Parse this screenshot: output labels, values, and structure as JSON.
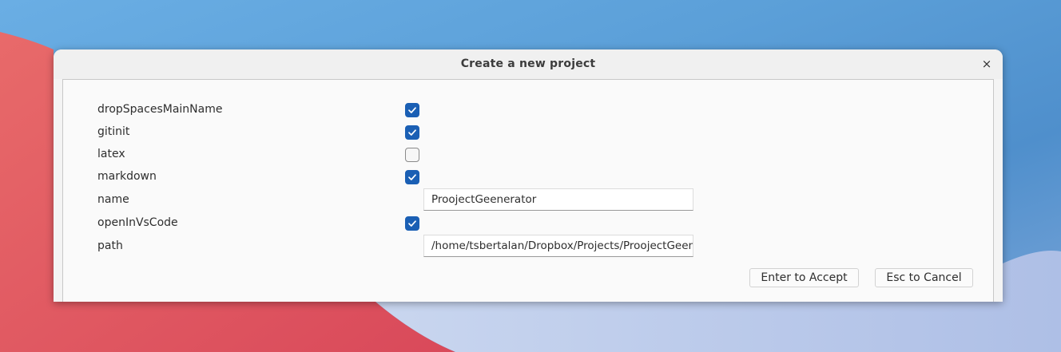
{
  "dialog": {
    "title": "Create a new project",
    "close_glyph": "×"
  },
  "fields": {
    "dropSpacesMainName": {
      "label": "dropSpacesMainName",
      "checked": true
    },
    "gitinit": {
      "label": "gitinit",
      "checked": true
    },
    "latex": {
      "label": "latex",
      "checked": false
    },
    "markdown": {
      "label": "markdown",
      "checked": true
    },
    "name": {
      "label": "name",
      "value": "ProojectGeenerator"
    },
    "openInVsCode": {
      "label": "openInVsCode",
      "checked": true
    },
    "path": {
      "label": "path",
      "value": "/home/tsbertalan/Dropbox/Projects/ProojectGeenerator"
    }
  },
  "buttons": {
    "accept_label": "Enter to Accept",
    "cancel_label": "Esc to Cancel"
  },
  "colors": {
    "accent": "#1a5fb4",
    "wallpaper_blue": "#5b9fd8",
    "wallpaper_red": "#e05a5a"
  }
}
